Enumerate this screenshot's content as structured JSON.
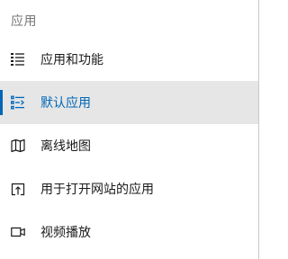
{
  "section": {
    "title": "应用"
  },
  "nav": {
    "items": [
      {
        "label": "应用和功能",
        "icon": "list-icon",
        "selected": false
      },
      {
        "label": "默认应用",
        "icon": "default-apps-icon",
        "selected": true
      },
      {
        "label": "离线地图",
        "icon": "map-icon",
        "selected": false
      },
      {
        "label": "用于打开网站的应用",
        "icon": "open-website-icon",
        "selected": false
      },
      {
        "label": "视频播放",
        "icon": "video-icon",
        "selected": false
      }
    ]
  },
  "colors": {
    "accent": "#0067b8",
    "selected_background": "#e6e6e6",
    "section_title": "#777777",
    "text": "#1a1a1a"
  }
}
